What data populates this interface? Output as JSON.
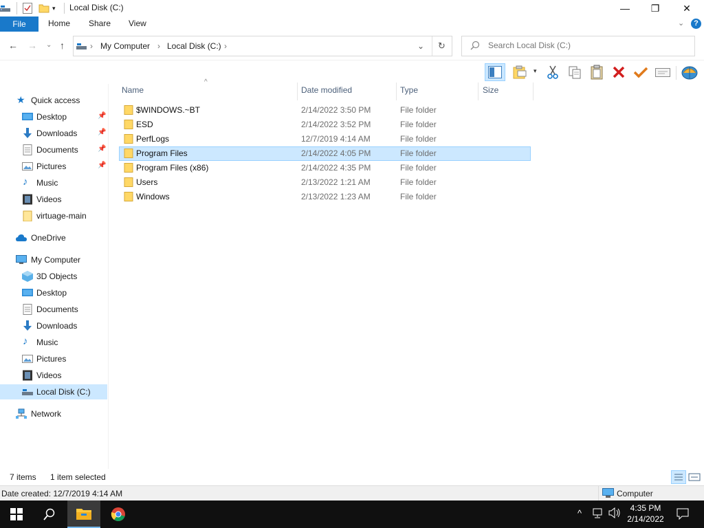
{
  "window": {
    "title": "Local Disk (C:)",
    "minimize_glyph": "—",
    "maximize_glyph": "❐",
    "close_glyph": "✕"
  },
  "ribbon": {
    "tabs": [
      "File",
      "Home",
      "Share",
      "View"
    ]
  },
  "address": {
    "crumbs": [
      "My Computer",
      "Local Disk (C:)"
    ],
    "search_placeholder": "Search Local Disk (C:)"
  },
  "navpane": {
    "quick_access": "Quick access",
    "quick_items": [
      "Desktop",
      "Downloads",
      "Documents",
      "Pictures",
      "Music",
      "Videos",
      "virtuage-main"
    ],
    "onedrive": "OneDrive",
    "my_computer": "My Computer",
    "computer_items": [
      "3D Objects",
      "Desktop",
      "Documents",
      "Downloads",
      "Music",
      "Pictures",
      "Videos",
      "Local Disk (C:)"
    ],
    "network": "Network"
  },
  "filelist": {
    "columns": [
      "Name",
      "Date modified",
      "Type",
      "Size"
    ],
    "rows": [
      {
        "name": "$WINDOWS.~BT",
        "date": "2/14/2022 3:50 PM",
        "type": "File folder",
        "size": ""
      },
      {
        "name": "ESD",
        "date": "2/14/2022 3:52 PM",
        "type": "File folder",
        "size": ""
      },
      {
        "name": "PerfLogs",
        "date": "12/7/2019 4:14 AM",
        "type": "File folder",
        "size": ""
      },
      {
        "name": "Program Files",
        "date": "2/14/2022 4:05 PM",
        "type": "File folder",
        "size": ""
      },
      {
        "name": "Program Files (x86)",
        "date": "2/14/2022 4:35 PM",
        "type": "File folder",
        "size": ""
      },
      {
        "name": "Users",
        "date": "2/13/2022 1:21 AM",
        "type": "File folder",
        "size": ""
      },
      {
        "name": "Windows",
        "date": "2/13/2022 1:23 AM",
        "type": "File folder",
        "size": ""
      }
    ],
    "selected_index": 3
  },
  "status": {
    "items_count": "7 items",
    "selected_count": "1 item selected"
  },
  "infobar": {
    "date_created": "Date created: 12/7/2019 4:14 AM",
    "location": "Computer"
  },
  "taskbar": {
    "time": "4:35 PM",
    "date": "2/14/2022"
  },
  "colors": {
    "accent": "#1979ca",
    "selection": "#cce8ff",
    "folder": "#ffd866",
    "taskbar": "#101010"
  }
}
